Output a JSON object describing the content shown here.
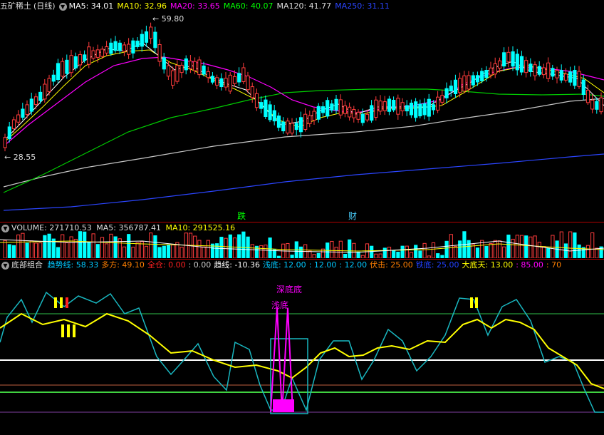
{
  "price_panel": {
    "stock_name": "五矿稀土",
    "period": "(日线)",
    "ma_labels": [
      {
        "text": "MA5: 34.01",
        "color": "#ffffff"
      },
      {
        "text": "MA10: 32.96",
        "color": "#ffff00"
      },
      {
        "text": "MA20: 33.65",
        "color": "#ff00ff"
      },
      {
        "text": "MA60: 40.07",
        "color": "#00ff00"
      },
      {
        "text": "MA120: 41.77",
        "color": "#dddddd"
      },
      {
        "text": "MA250: 31.11",
        "color": "#2b45ff"
      }
    ],
    "high_label": "59.80",
    "low_label": "28.55",
    "event_labels": [
      "跌",
      "财"
    ]
  },
  "volume_panel": {
    "label": "VOLUME: 271710.53",
    "ma5": "MA5: 356787.41",
    "ma10": "MA10: 291525.16"
  },
  "indicator_panel": {
    "name": "底部组合",
    "items": [
      {
        "text": "趋势线: 58.33",
        "color": "#00c8ff"
      },
      {
        "text": "多方: 49.10",
        "color": "#ff7f00"
      },
      {
        "text": "全仓: 0.00",
        "color": "#ff2020"
      },
      {
        "text": ": 0.00",
        "color": "#cccccc"
      },
      {
        "text": "趋线: -10.36",
        "color": "#ffffff"
      },
      {
        "text": "浅底: 12.00",
        "color": "#00c8ff"
      },
      {
        "text": ": 12.00",
        "color": "#00c8ff"
      },
      {
        "text": ": 12.00",
        "color": "#00c8ff"
      },
      {
        "text": "伏击: 25.00",
        "color": "#ff7f00"
      },
      {
        "text": "铁底: 25.00",
        "color": "#2040ff"
      },
      {
        "text": "大底天: 13.00",
        "color": "#ffff00"
      },
      {
        "text": ": 85.00",
        "color": "#ff00ff"
      },
      {
        "text": ": 70",
        "color": "#ff7f00"
      }
    ],
    "annotations": {
      "deep_bottom": "深底底",
      "shallow_bottom": "浅底"
    }
  }
}
